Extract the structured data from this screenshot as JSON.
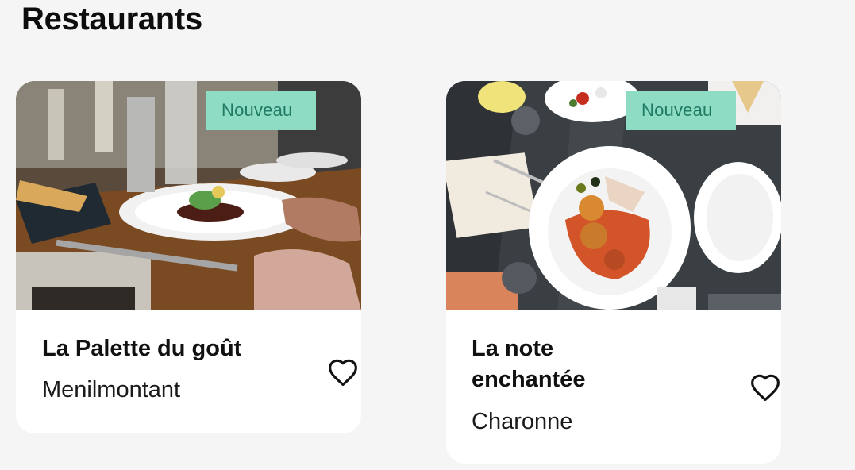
{
  "page": {
    "title": "Restaurants"
  },
  "restaurants": [
    {
      "name": "La Palette du goût",
      "location": "Menilmontant",
      "badge": "Nouveau",
      "favorite_icon": "heart-outline-icon"
    },
    {
      "name": "La note enchantée",
      "location": "Charonne",
      "badge": "Nouveau",
      "favorite_icon": "heart-outline-icon"
    }
  ],
  "colors": {
    "background": "#f5f5f5",
    "card": "#ffffff",
    "badge_bg": "#8fdcc4",
    "badge_text": "#1f7a64"
  }
}
